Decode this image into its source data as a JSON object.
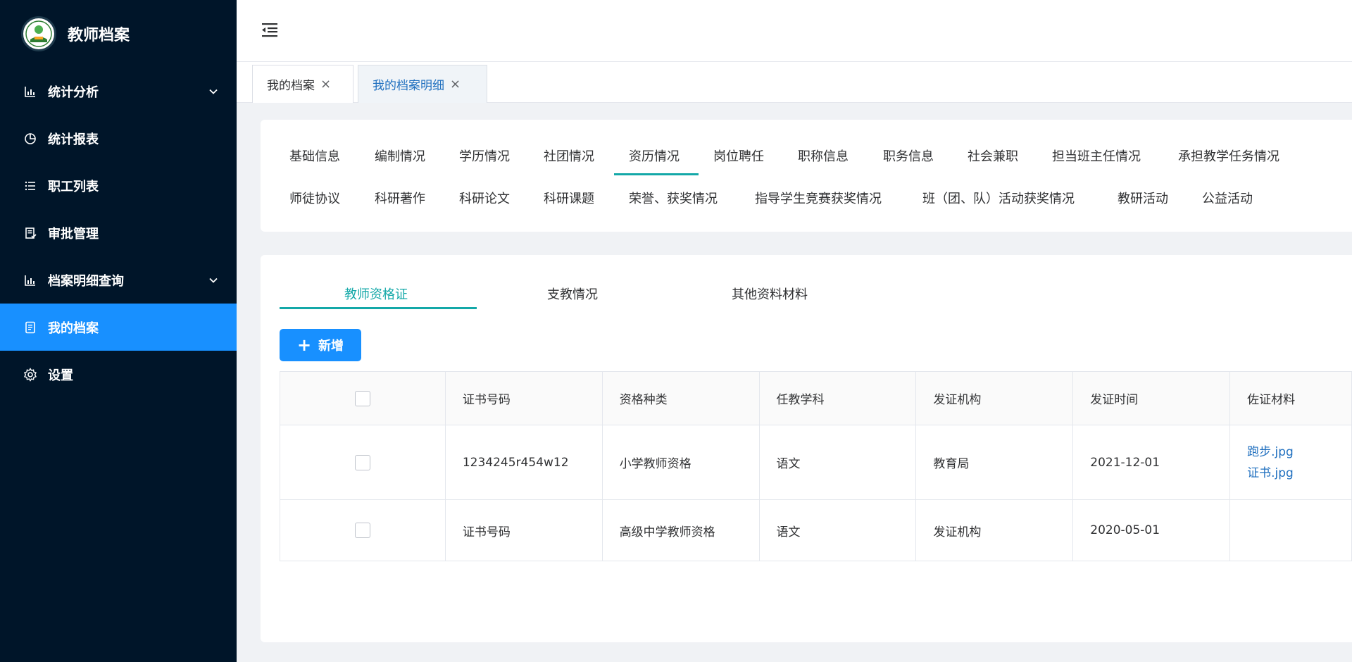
{
  "app": {
    "title": "教师档案"
  },
  "sidebar": {
    "items": [
      {
        "label": "统计分析",
        "icon": "bar-chart-icon",
        "has_children": true
      },
      {
        "label": "统计报表",
        "icon": "pie-chart-icon",
        "has_children": false
      },
      {
        "label": "职工列表",
        "icon": "list-icon",
        "has_children": false
      },
      {
        "label": "审批管理",
        "icon": "approval-icon",
        "has_children": false
      },
      {
        "label": "档案明细查询",
        "icon": "bar-chart-icon",
        "has_children": true
      },
      {
        "label": "我的档案",
        "icon": "document-icon",
        "has_children": false,
        "active": true
      },
      {
        "label": "设置",
        "icon": "gear-icon",
        "has_children": false
      }
    ]
  },
  "page_tabs": [
    {
      "label": "我的档案",
      "active": false
    },
    {
      "label": "我的档案明细",
      "active": true
    }
  ],
  "categories": {
    "row1": [
      "基础信息",
      "编制情况",
      "学历情况",
      "社团情况",
      "资历情况",
      "岗位聘任",
      "职称信息",
      "职务信息",
      "社会兼职",
      "担当班主任情况",
      "承担教学任务情况"
    ],
    "row2": [
      "师徒协议",
      "科研著作",
      "科研论文",
      "科研课题",
      "荣誉、获奖情况",
      "指导学生竞赛获奖情况",
      "班（团、队）活动获奖情况",
      "教研活动",
      "公益活动"
    ],
    "active": "资历情况"
  },
  "subtabs": [
    "教师资格证",
    "支教情况",
    "其他资料材料"
  ],
  "add_button": {
    "label": "新增"
  },
  "table": {
    "headers": [
      "证书号码",
      "资格种类",
      "任教学科",
      "发证机构",
      "发证时间",
      "佐证材料"
    ],
    "rows": [
      {
        "cert_no": "1234245r454w12",
        "type": "小学教师资格",
        "subject": "语文",
        "issuer": "教育局",
        "date": "2021-12-01",
        "files": [
          "跑步.jpg",
          "证书.jpg"
        ]
      },
      {
        "cert_no": "证书号码",
        "type": "高级中学教师资格",
        "subject": "语文",
        "issuer": "发证机构",
        "date": "2020-05-01",
        "files": []
      }
    ]
  },
  "colors": {
    "sidebar_bg": "#001529",
    "active_menu": "#1890ff",
    "accent_teal": "#13a8a8",
    "link": "#1f6fbf"
  }
}
